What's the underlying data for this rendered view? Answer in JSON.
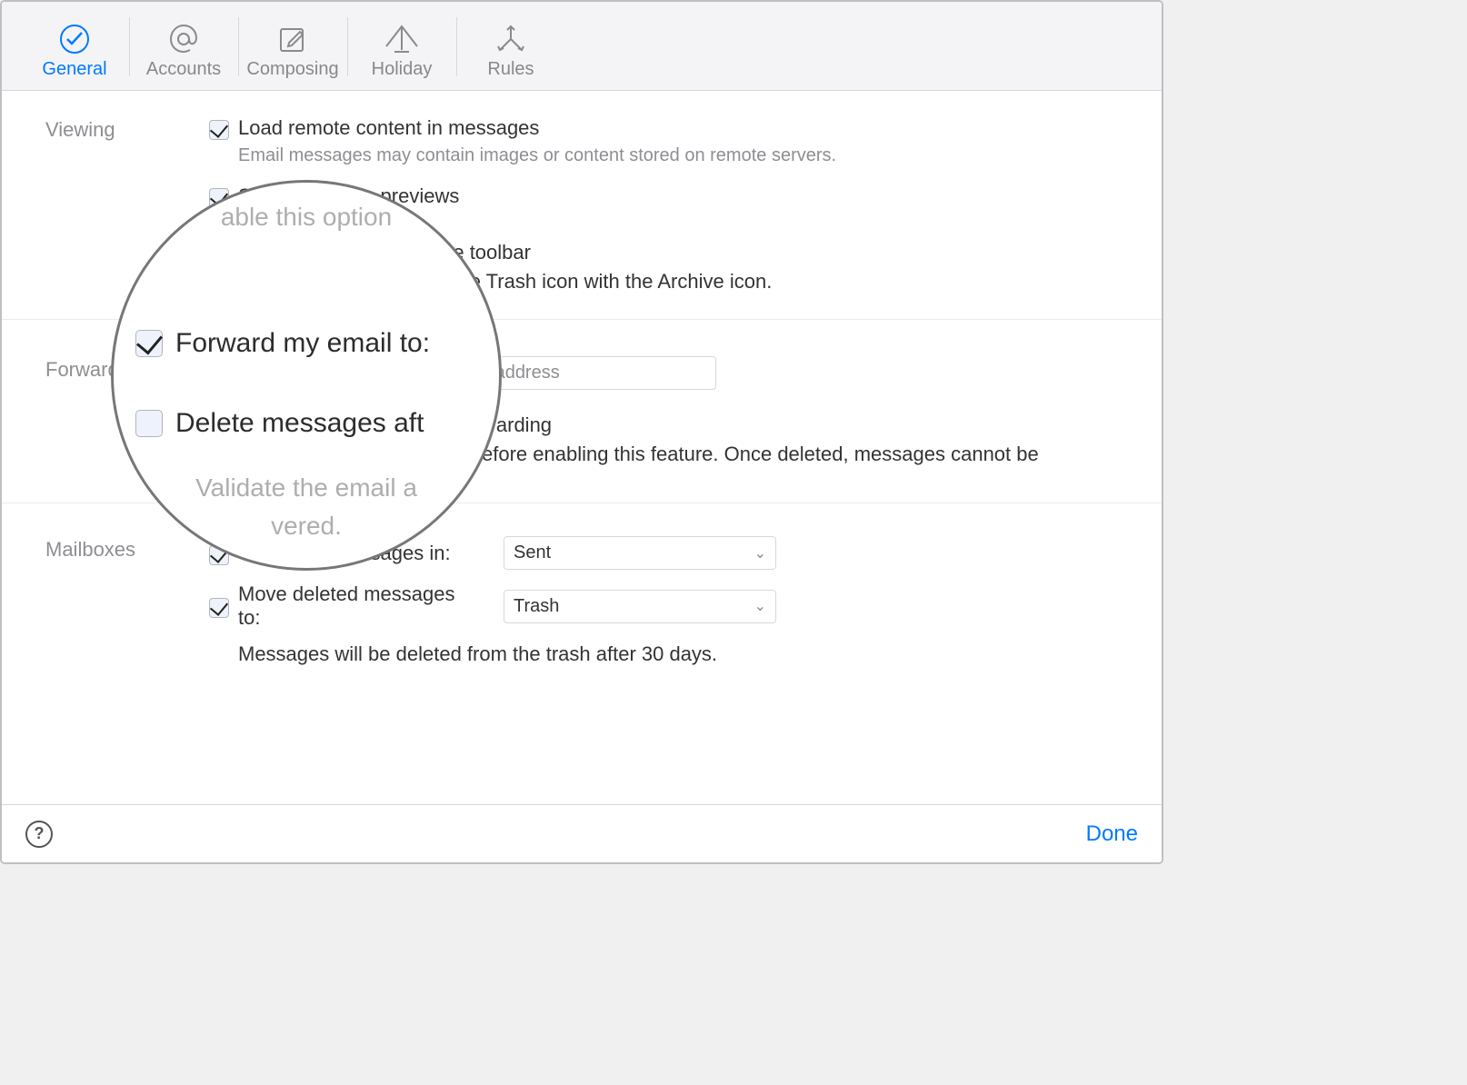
{
  "tabs": {
    "general": "General",
    "accounts": "Accounts",
    "composing": "Composing",
    "holiday": "Holiday",
    "rules": "Rules"
  },
  "sections": {
    "viewing": {
      "title": "Viewing",
      "load_remote": "Load remote content in messages",
      "load_remote_desc": "Email messages may contain images or content stored on remote servers.",
      "show_previews": "Show message previews",
      "previews_desc_partial": "able this option",
      "toolbar_suffix": "the toolbar",
      "toolbar_desc_partial": "e the Trash icon with the Archive icon."
    },
    "forwarding": {
      "title": "Forwarding",
      "forward_label": "Forward my email to:",
      "placeholder": "r email address",
      "warding_suffix": "warding",
      "delete_after": "Delete messages aft",
      "delete_desc_partial": "efore enabling this feature. Once deleted, messages cannot be",
      "validate_partial": "Validate the email a",
      "vered": "vered."
    },
    "mailboxes": {
      "title": "Mailboxes",
      "save_sent": "Save sent messages in:",
      "save_sent_value": "Sent",
      "move_deleted": "Move deleted messages to:",
      "move_deleted_value": "Trash",
      "trash_note": "Messages will be deleted from the trash after 30 days."
    }
  },
  "footer": {
    "done": "Done"
  }
}
